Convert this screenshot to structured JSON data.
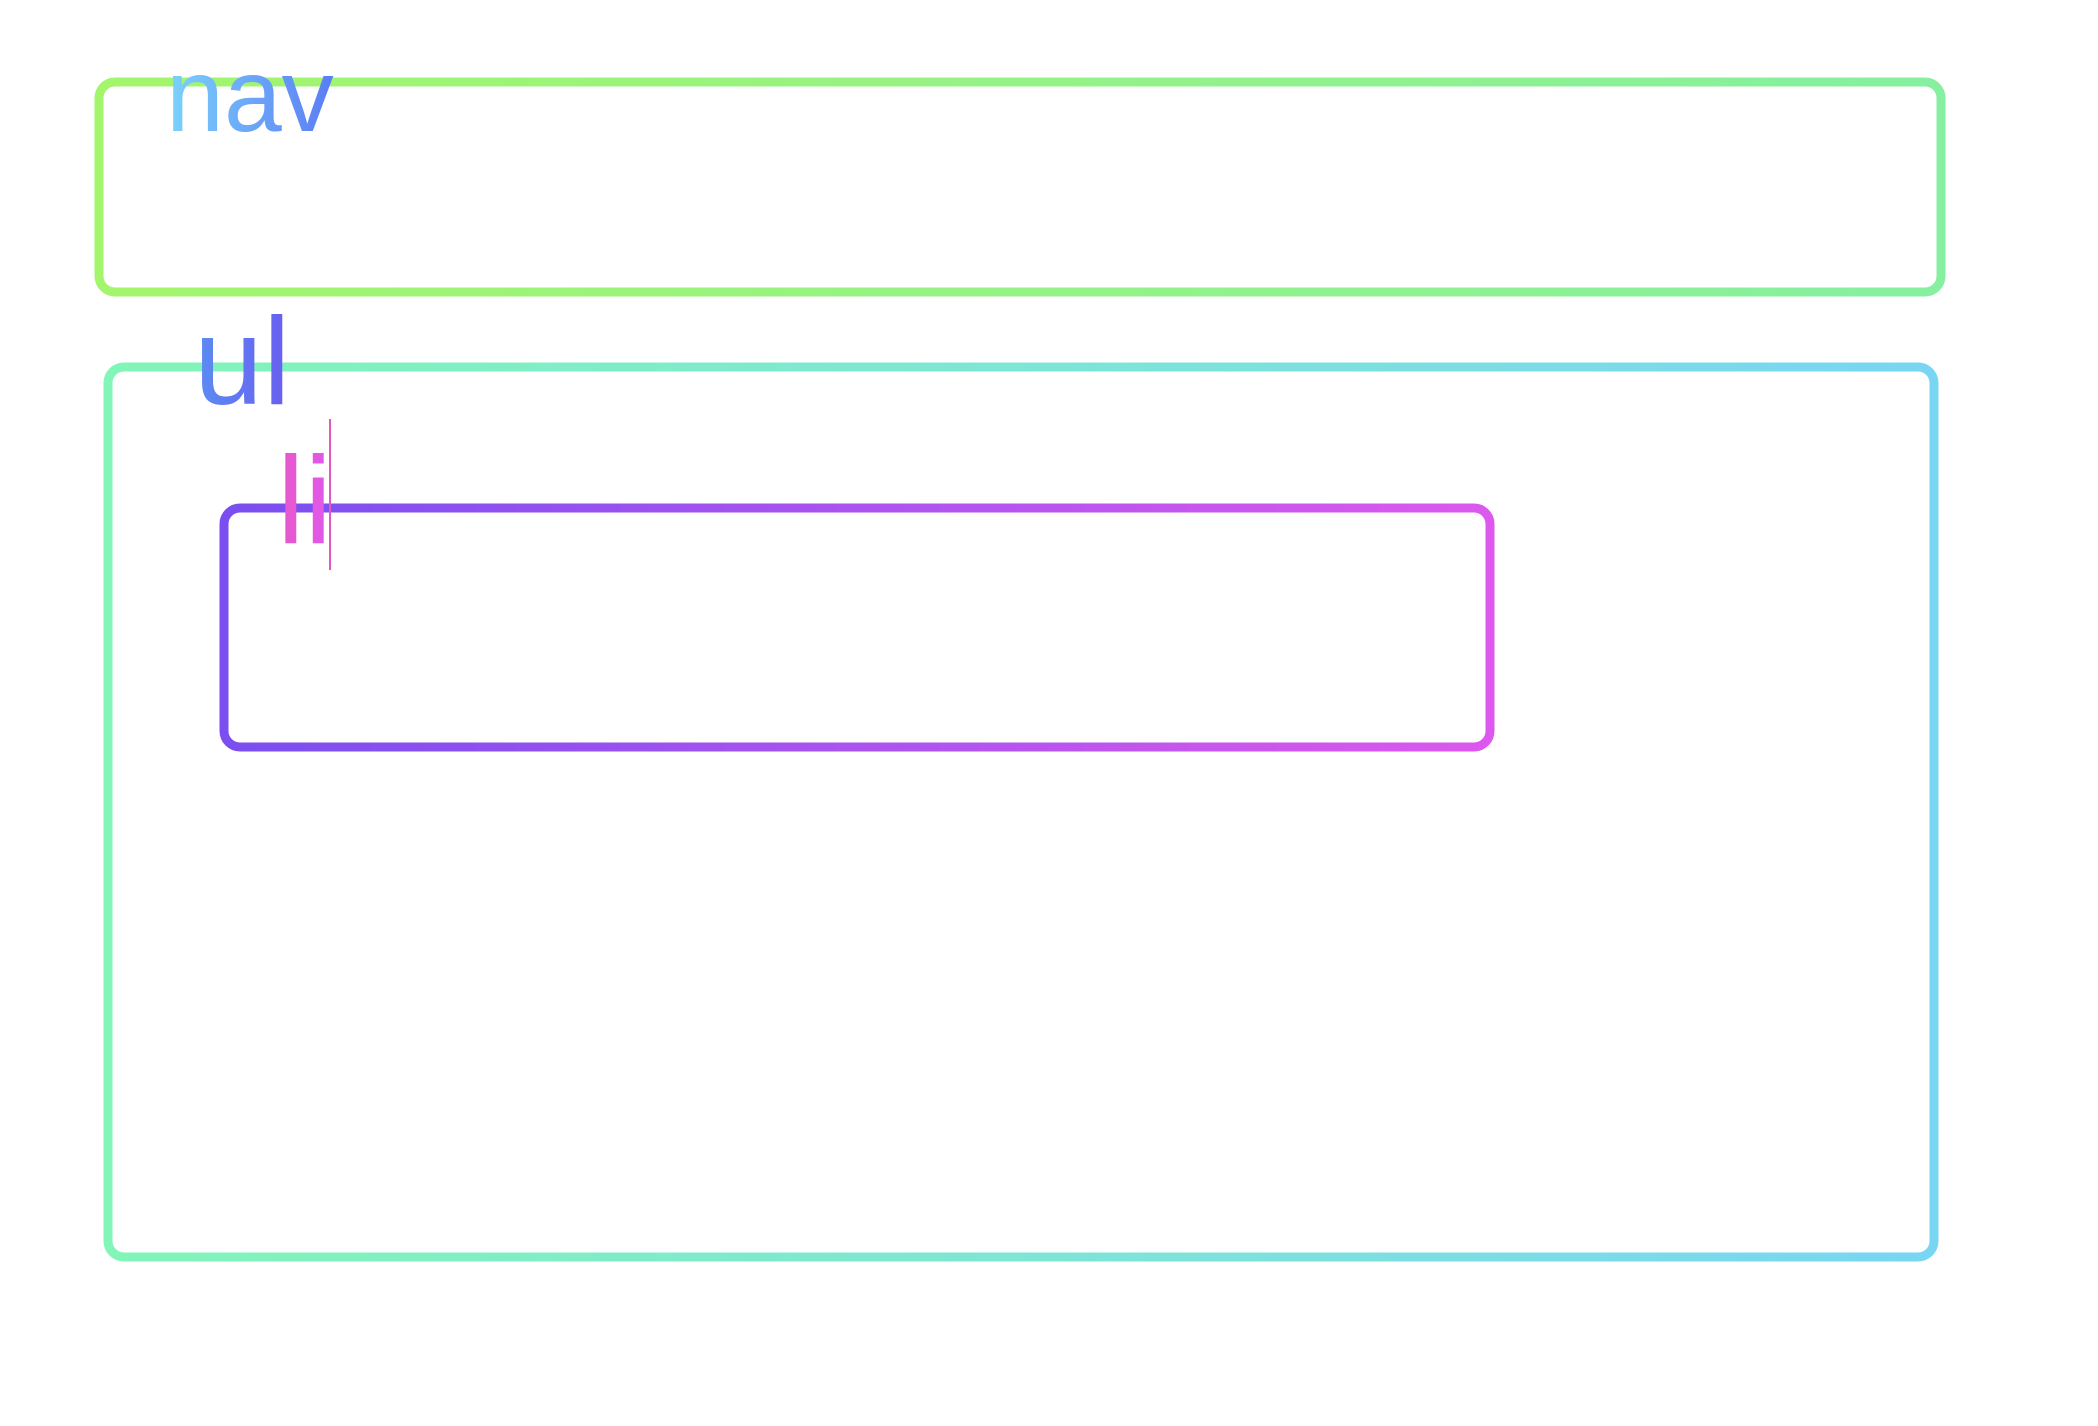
{
  "diagram": {
    "nav": {
      "label": "nav",
      "colors": {
        "border_start": "#a3f56b",
        "border_end": "#86f0a0",
        "label_start": "#7cd3fb",
        "label_end": "#5b7cf4"
      }
    },
    "ul": {
      "label": "ul",
      "colors": {
        "border_start": "#82f5b8",
        "border_end": "#78d6f2",
        "label_start": "#5b8ef2",
        "label_end": "#6a5cf2"
      }
    },
    "li": {
      "label": "li",
      "colors": {
        "border_start": "#7a4ef0",
        "border_end": "#dc58ee",
        "label_start": "#e858c8",
        "label_end": "#e058ee"
      },
      "text_cursor": true
    }
  }
}
